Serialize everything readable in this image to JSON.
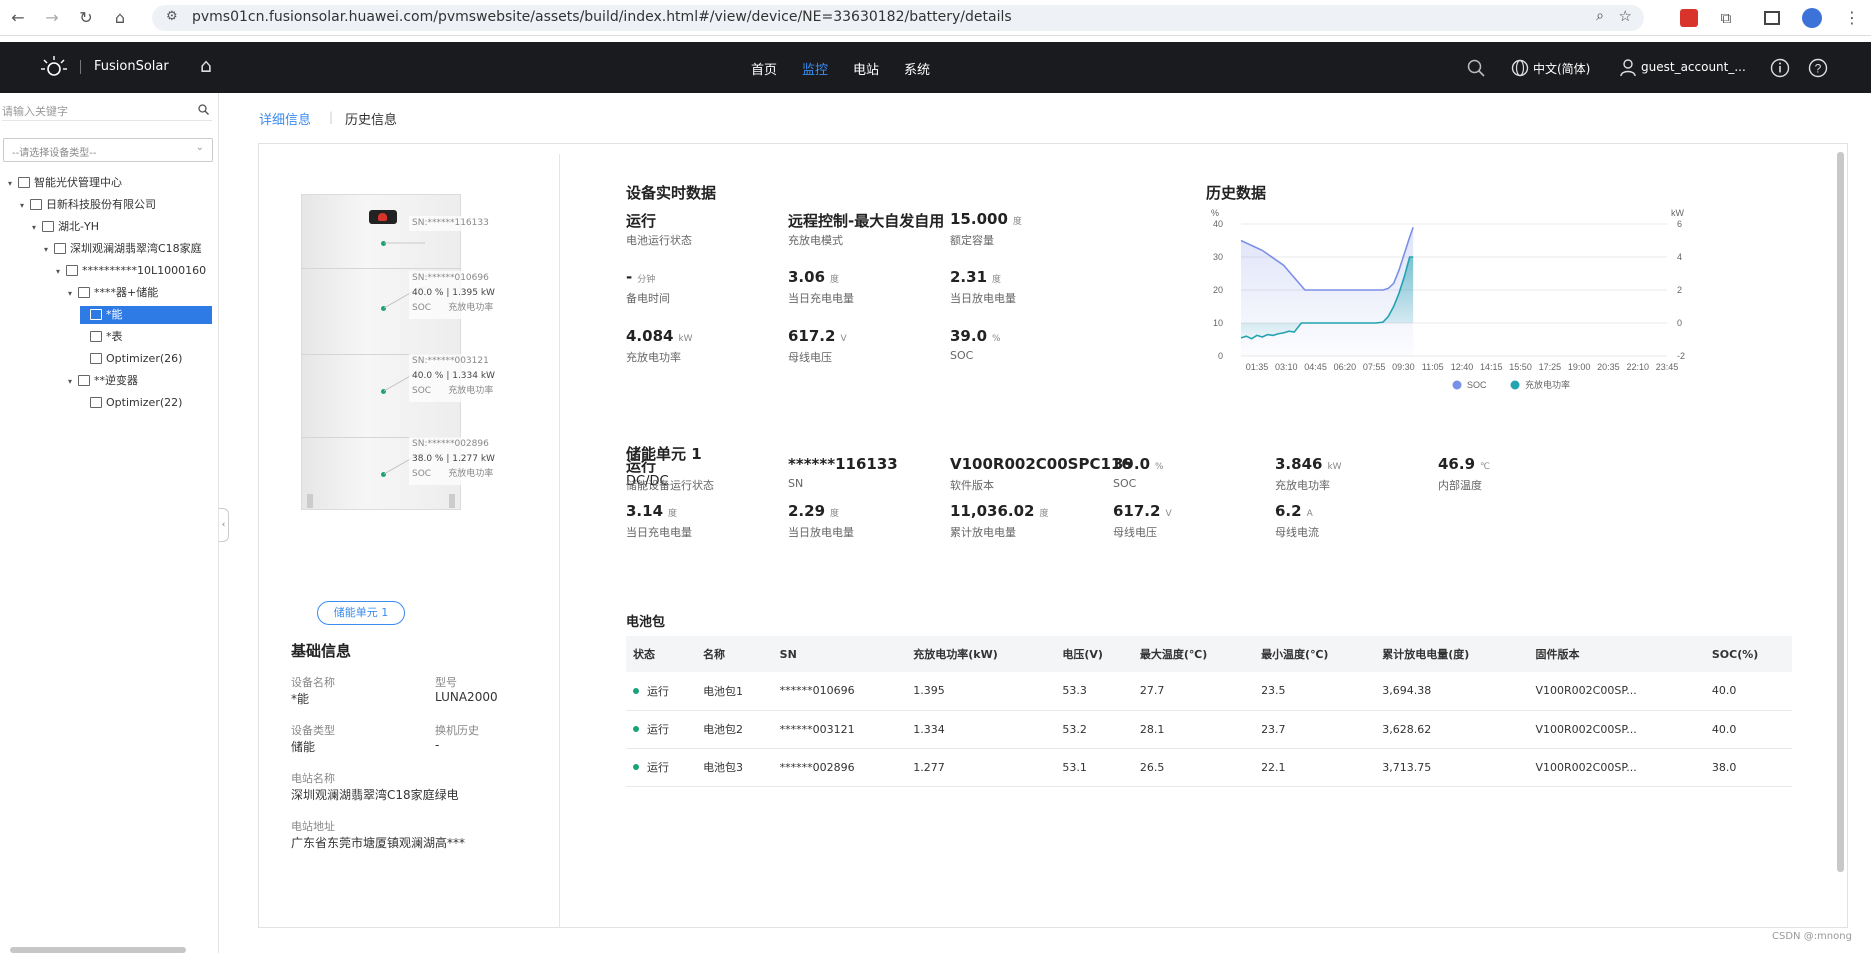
{
  "browser": {
    "url": "pvms01cn.fusionsolar.huawei.com/pvmswebsite/assets/build/index.html#/view/device/NE=33630182/battery/details"
  },
  "header": {
    "brand": "FusionSolar",
    "menu": [
      "首页",
      "监控",
      "电站",
      "系统"
    ],
    "active_menu": "监控",
    "language": "中文(简体)",
    "user": "guest_account_..."
  },
  "sidebar": {
    "search_placeholder": "请输入关键字",
    "type_select": "--请选择设备类型--",
    "tree": [
      {
        "label": "智能光伏管理中心",
        "depth": 0
      },
      {
        "label": "日新科技股份有限公司",
        "depth": 1
      },
      {
        "label": "湖北-YH",
        "depth": 2
      },
      {
        "label": "深圳观澜湖翡翠湾C18家庭",
        "depth": 3
      },
      {
        "label": "**********10L1000160",
        "depth": 4
      },
      {
        "label": "****器+储能",
        "depth": 5
      },
      {
        "label": "*能",
        "depth": 6,
        "selected": true
      },
      {
        "label": "*表",
        "depth": 6
      },
      {
        "label": "Optimizer(26)",
        "depth": 6
      },
      {
        "label": "**逆变器",
        "depth": 5
      },
      {
        "label": "Optimizer(22)",
        "depth": 6
      }
    ]
  },
  "tabs": [
    "详细信息",
    "历史信息"
  ],
  "active_tab": "详细信息",
  "device_image": {
    "modules": [
      {
        "sn": "SN:******116133"
      },
      {
        "sn": "SN:******010696",
        "soc": "40.0 %",
        "power": "1.395 kW",
        "soc_label": "SOC",
        "power_label": "充放电功率"
      },
      {
        "sn": "SN:******003121",
        "soc": "40.0 %",
        "power": "1.334 kW",
        "soc_label": "SOC",
        "power_label": "充放电功率"
      },
      {
        "sn": "SN:******002896",
        "soc": "38.0 %",
        "power": "1.277 kW",
        "soc_label": "SOC",
        "power_label": "充放电功率"
      }
    ],
    "unit_button": "储能单元 1"
  },
  "basic": {
    "title": "基础信息",
    "device_name_label": "设备名称",
    "device_name": "*能",
    "model_label": "型号",
    "model": "LUNA2000",
    "device_type_label": "设备类型",
    "device_type": "储能",
    "swap_history_label": "换机历史",
    "swap_history": "-",
    "station_name_label": "电站名称",
    "station_name": "深圳观澜湖翡翠湾C18家庭绿电",
    "station_addr_label": "电站地址",
    "station_addr": "广东省东莞市塘厦镇观澜湖高***"
  },
  "realtime": {
    "title": "设备实时数据",
    "items": [
      {
        "value": "运行",
        "unit": "",
        "label": "电池运行状态"
      },
      {
        "value": "远程控制-最大自发自用",
        "unit": "",
        "label": "充放电模式"
      },
      {
        "value": "15.000",
        "unit": "度",
        "label": "额定容量"
      },
      {
        "value": "-",
        "unit": "分钟",
        "label": "备电时间"
      },
      {
        "value": "3.06",
        "unit": "度",
        "label": "当日充电电量"
      },
      {
        "value": "2.31",
        "unit": "度",
        "label": "当日放电电量"
      },
      {
        "value": "4.084",
        "unit": "kW",
        "label": "充放电功率"
      },
      {
        "value": "617.2",
        "unit": "V",
        "label": "母线电压"
      },
      {
        "value": "39.0",
        "unit": "%",
        "label": "SOC"
      }
    ]
  },
  "unit": {
    "title": "储能单元 1",
    "subtitle": "DC/DC",
    "items": [
      {
        "value": "运行",
        "unit": "",
        "label": "储能设备运行状态"
      },
      {
        "value": "******116133",
        "unit": "",
        "label": "SN"
      },
      {
        "value": "V100R002C00SPC116",
        "unit": "",
        "label": "软件版本"
      },
      {
        "value": "39.0",
        "unit": "%",
        "label": "SOC"
      },
      {
        "value": "3.846",
        "unit": "kW",
        "label": "充放电功率"
      },
      {
        "value": "46.9",
        "unit": "℃",
        "label": "内部温度"
      },
      {
        "value": "3.14",
        "unit": "度",
        "label": "当日充电电量"
      },
      {
        "value": "2.29",
        "unit": "度",
        "label": "当日放电电量"
      },
      {
        "value": "11,036.02",
        "unit": "度",
        "label": "累计放电电量"
      },
      {
        "value": "617.2",
        "unit": "V",
        "label": "母线电压"
      },
      {
        "value": "6.2",
        "unit": "A",
        "label": "母线电流"
      }
    ]
  },
  "battery_pack": {
    "title": "电池包",
    "headers": [
      "状态",
      "名称",
      "SN",
      "充放电功率(kW)",
      "电压(V)",
      "最大温度(℃)",
      "最小温度(℃)",
      "累计放电电量(度)",
      "固件版本",
      "SOC(%)"
    ],
    "rows": [
      [
        "运行",
        "电池包1",
        "******010696",
        "1.395",
        "53.3",
        "27.7",
        "23.5",
        "3,694.38",
        "V100R002C00SP...",
        "40.0"
      ],
      [
        "运行",
        "电池包2",
        "******003121",
        "1.334",
        "53.2",
        "28.1",
        "23.7",
        "3,628.62",
        "V100R002C00SP...",
        "40.0"
      ],
      [
        "运行",
        "电池包3",
        "******002896",
        "1.277",
        "53.1",
        "26.5",
        "22.1",
        "3,713.75",
        "V100R002C00SP...",
        "38.0"
      ]
    ]
  },
  "chart_data": {
    "type": "line",
    "title": "历史数据",
    "y_left_unit": "%",
    "y_right_unit": "kW",
    "ylim_left": [
      0,
      40
    ],
    "ylim_right": [
      -2,
      6
    ],
    "y_left_ticks": [
      "0",
      "10",
      "20",
      "30",
      "40"
    ],
    "y_right_ticks": [
      "-2",
      "0",
      "2",
      "4",
      "6"
    ],
    "x_ticks": [
      "01:35",
      "03:10",
      "04:45",
      "06:20",
      "07:55",
      "09:30",
      "11:05",
      "12:40",
      "14:15",
      "15:50",
      "17:25",
      "19:00",
      "20:35",
      "22:10",
      "23:45"
    ],
    "x_range_hours": [
      0,
      24
    ],
    "legend_placement": "bottom",
    "colors": {
      "soc": "#7a8fe6",
      "power": "#23a3b0"
    },
    "series": [
      {
        "name": "SOC",
        "axis": "left",
        "points": [
          [
            0,
            35
          ],
          [
            0.4,
            34
          ],
          [
            0.8,
            33
          ],
          [
            1.2,
            32
          ],
          [
            1.6,
            30.5
          ],
          [
            2.0,
            29
          ],
          [
            2.4,
            27.5
          ],
          [
            2.8,
            25
          ],
          [
            3.2,
            22.5
          ],
          [
            3.6,
            20
          ],
          [
            4.5,
            20
          ],
          [
            5.5,
            20
          ],
          [
            6.5,
            20
          ],
          [
            7.5,
            20
          ],
          [
            8.0,
            20
          ],
          [
            8.3,
            20.5
          ],
          [
            8.6,
            22
          ],
          [
            8.9,
            26
          ],
          [
            9.2,
            31
          ],
          [
            9.5,
            36
          ],
          [
            9.7,
            39
          ]
        ]
      },
      {
        "name": "充放电功率",
        "axis": "right",
        "points": [
          [
            0,
            -0.9
          ],
          [
            0.3,
            -0.8
          ],
          [
            0.6,
            -0.95
          ],
          [
            0.9,
            -0.75
          ],
          [
            1.2,
            -0.85
          ],
          [
            1.5,
            -0.7
          ],
          [
            1.8,
            -0.75
          ],
          [
            2.1,
            -0.65
          ],
          [
            2.4,
            -0.6
          ],
          [
            2.7,
            -0.5
          ],
          [
            3.0,
            -0.55
          ],
          [
            3.4,
            0
          ],
          [
            4.0,
            0
          ],
          [
            5.0,
            0
          ],
          [
            6.0,
            0
          ],
          [
            7.0,
            0
          ],
          [
            7.6,
            0
          ],
          [
            8.0,
            0.05
          ],
          [
            8.3,
            0.4
          ],
          [
            8.6,
            1.0
          ],
          [
            8.9,
            1.8
          ],
          [
            9.2,
            2.8
          ],
          [
            9.5,
            4.0
          ],
          [
            9.7,
            4.0
          ]
        ]
      }
    ]
  },
  "watermark": "CSDN @:mnong"
}
